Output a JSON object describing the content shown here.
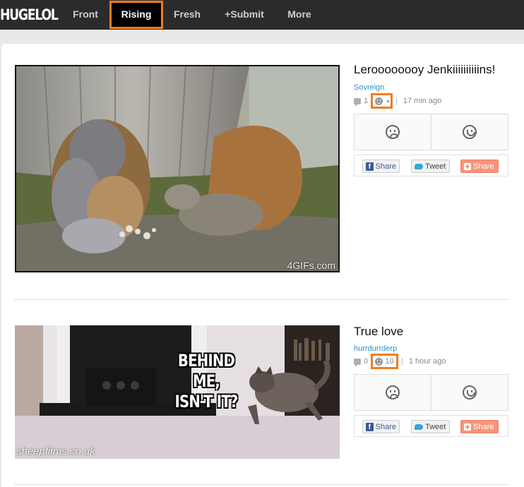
{
  "nav": {
    "logo": "HUGELOL",
    "items": [
      {
        "label": "Front"
      },
      {
        "label": "Rising"
      },
      {
        "label": "Fresh"
      },
      {
        "label": "+Submit"
      },
      {
        "label": "More"
      }
    ],
    "active": "Rising"
  },
  "posts": [
    {
      "title": "Leroooooooy Jenkiiiiiiiiiins!",
      "author": "Sovreign",
      "comments": "1",
      "score": "",
      "time": "17 min ago",
      "watermark": "4GIFs.com"
    },
    {
      "title": "True love",
      "author": "hurrdurrderp",
      "comments": "0",
      "score": "10",
      "time": "1 hour ago",
      "caption_line1": "BEHIND ME,",
      "caption_line2": "ISN'T IT?",
      "watermark": "sheepfilms.co.uk"
    }
  ],
  "share": {
    "facebook": "Share",
    "twitter": "Tweet",
    "other": "Share"
  },
  "colors": {
    "nav_bg": "#2b2b2b",
    "highlight": "#f07d1e",
    "author_link": "#2e8fc8"
  }
}
